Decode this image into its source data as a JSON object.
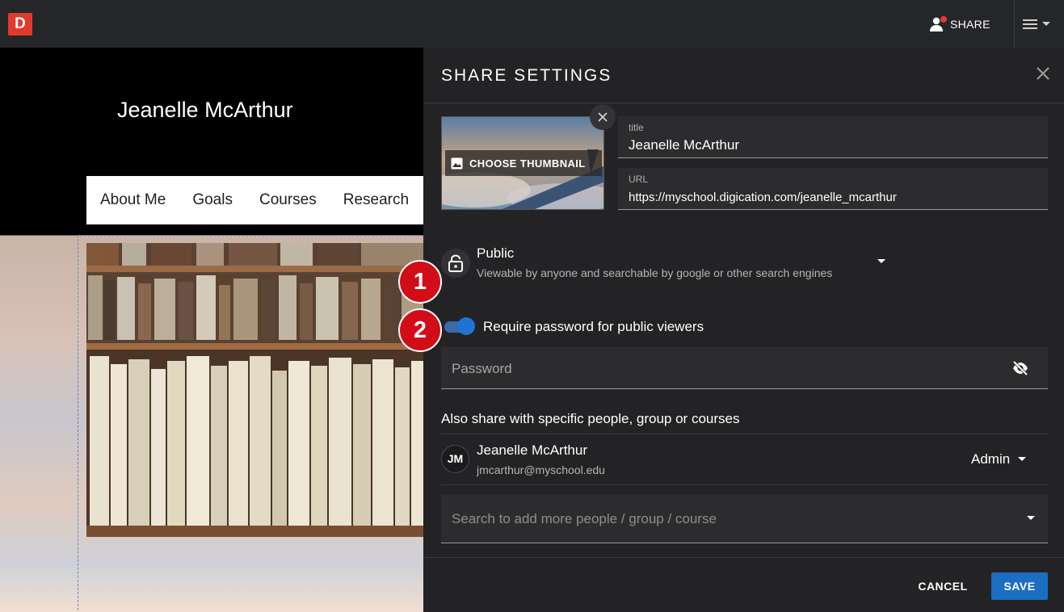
{
  "topbar": {
    "logo_letter": "D",
    "share_label": "SHARE"
  },
  "preview": {
    "site_name": "Jeanelle McArthur",
    "nav_items": [
      "About Me",
      "Goals",
      "Courses",
      "Research"
    ]
  },
  "share_panel": {
    "title": "SHARE SETTINGS",
    "thumbnail_button_label": "CHOOSE THUMBNAIL",
    "title_field": {
      "label": "title",
      "value": "Jeanelle McArthur"
    },
    "url_field": {
      "label": "URL",
      "value": "https://myschool.digication.com/jeanelle_mcarthur"
    },
    "visibility": {
      "title": "Public",
      "description": "Viewable by anyone and searchable by google or other search engines"
    },
    "badges": [
      "1",
      "2"
    ],
    "password_toggle": {
      "label": "Require password for public viewers",
      "enabled": true
    },
    "password_field": {
      "placeholder": "Password"
    },
    "share_with_label": "Also share with specific people, group or courses",
    "people": [
      {
        "initials": "JM",
        "name": "Jeanelle McArthur",
        "email": "jmcarthur@myschool.edu",
        "role": "Admin"
      }
    ],
    "search_field": {
      "placeholder": "Search to add more people / group / course"
    },
    "cancel_label": "CANCEL",
    "save_label": "SAVE"
  },
  "colors": {
    "accent": "#1b6ec2",
    "toggle": "#1e74d4",
    "badge": "#d20d17",
    "logo": "#e03a2c",
    "panel_bg": "#232325"
  }
}
